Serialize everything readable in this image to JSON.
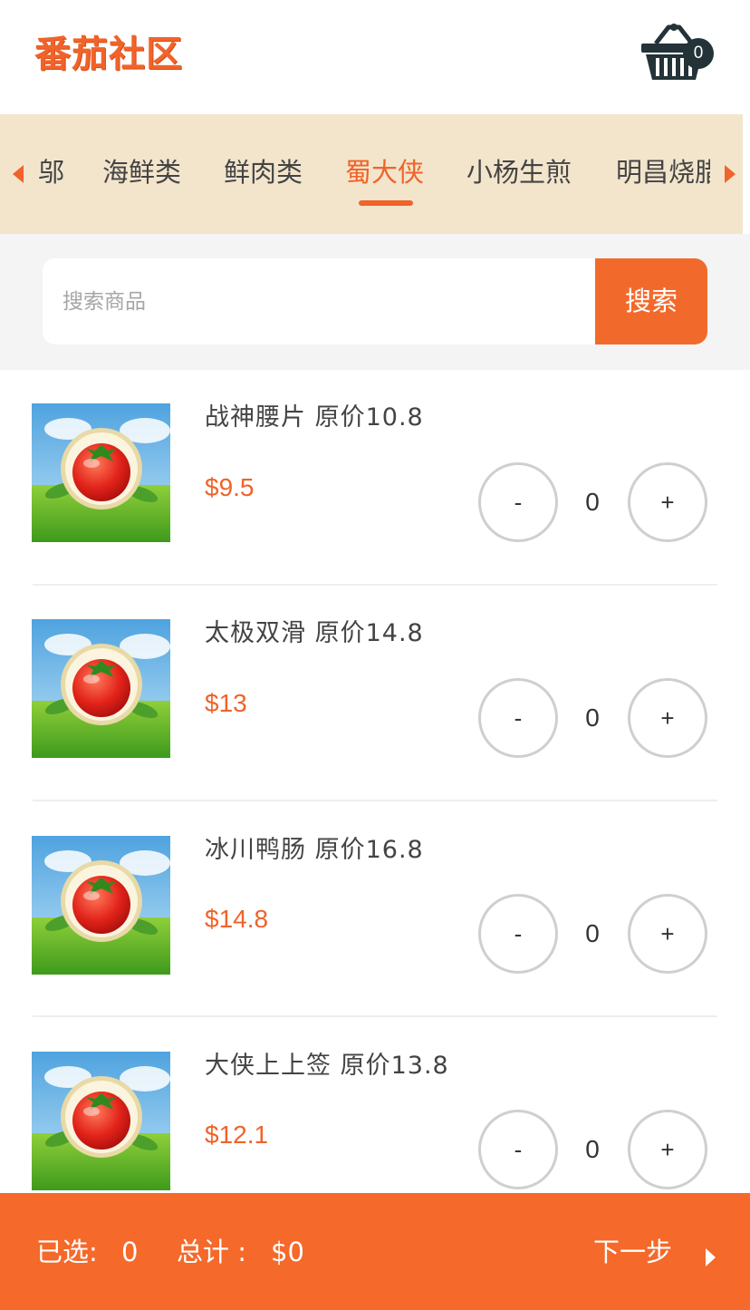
{
  "header": {
    "logo_text": "番茄社区",
    "cart_count": "0"
  },
  "colors": {
    "accent": "#f0632a",
    "category_bg": "#f3e5cc",
    "badge": "#233338",
    "footer": "#f5692a"
  },
  "categories": [
    {
      "label": "邬",
      "active": false
    },
    {
      "label": "海鲜类",
      "active": false
    },
    {
      "label": "鲜肉类",
      "active": false
    },
    {
      "label": "蜀大侠",
      "active": true
    },
    {
      "label": "小杨生煎",
      "active": false
    },
    {
      "label": "明昌烧腊",
      "active": false
    }
  ],
  "search": {
    "placeholder": "搜索商品",
    "value": "",
    "button_label": "搜索"
  },
  "products": [
    {
      "name": "战神腰片 原价10.8",
      "price": "$9.5",
      "quantity": "0",
      "minus": "-",
      "plus": "+"
    },
    {
      "name": "太极双滑 原价14.8",
      "price": "$13",
      "quantity": "0",
      "minus": "-",
      "plus": "+"
    },
    {
      "name": "冰川鸭肠 原价16.8",
      "price": "$14.8",
      "quantity": "0",
      "minus": "-",
      "plus": "+"
    },
    {
      "name": "大侠上上签 原价13.8",
      "price": "$12.1",
      "quantity": "0",
      "minus": "-",
      "plus": "+"
    }
  ],
  "footer": {
    "selected_label": "已选:",
    "selected_value": "0",
    "total_label": "总计 :",
    "total_value": "$0",
    "next_label": "下一步"
  },
  "icons": {
    "cart": "shopping-basket-icon",
    "left": "caret-left-icon",
    "right": "caret-right-icon",
    "product": "tomato-icon",
    "next": "caret-right-icon"
  }
}
